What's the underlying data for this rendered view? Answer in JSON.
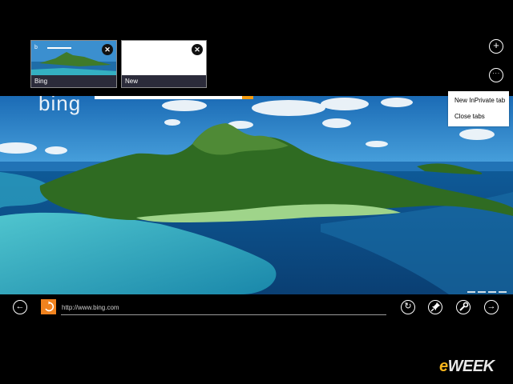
{
  "tabs": [
    {
      "label": "Bing",
      "close_symbol": "✕"
    },
    {
      "label": "New",
      "close_symbol": "✕"
    }
  ],
  "top_actions": {
    "new_tab_icon": "+",
    "more_icon": "···"
  },
  "menu": {
    "items": [
      "New InPrivate tab",
      "Close tabs"
    ]
  },
  "page": {
    "logo_text": "bing"
  },
  "address_bar": {
    "url": "http://www.bing.com",
    "back_icon": "←",
    "refresh_icon": "↻",
    "pin_icon": "pin",
    "tools_icon": "wrench",
    "forward_icon": "→"
  },
  "watermark": {
    "brand": "eWEEK"
  },
  "colors": {
    "site_icon": "#f0821e",
    "background": "#000000",
    "watermark_e": "#f7b51c"
  }
}
